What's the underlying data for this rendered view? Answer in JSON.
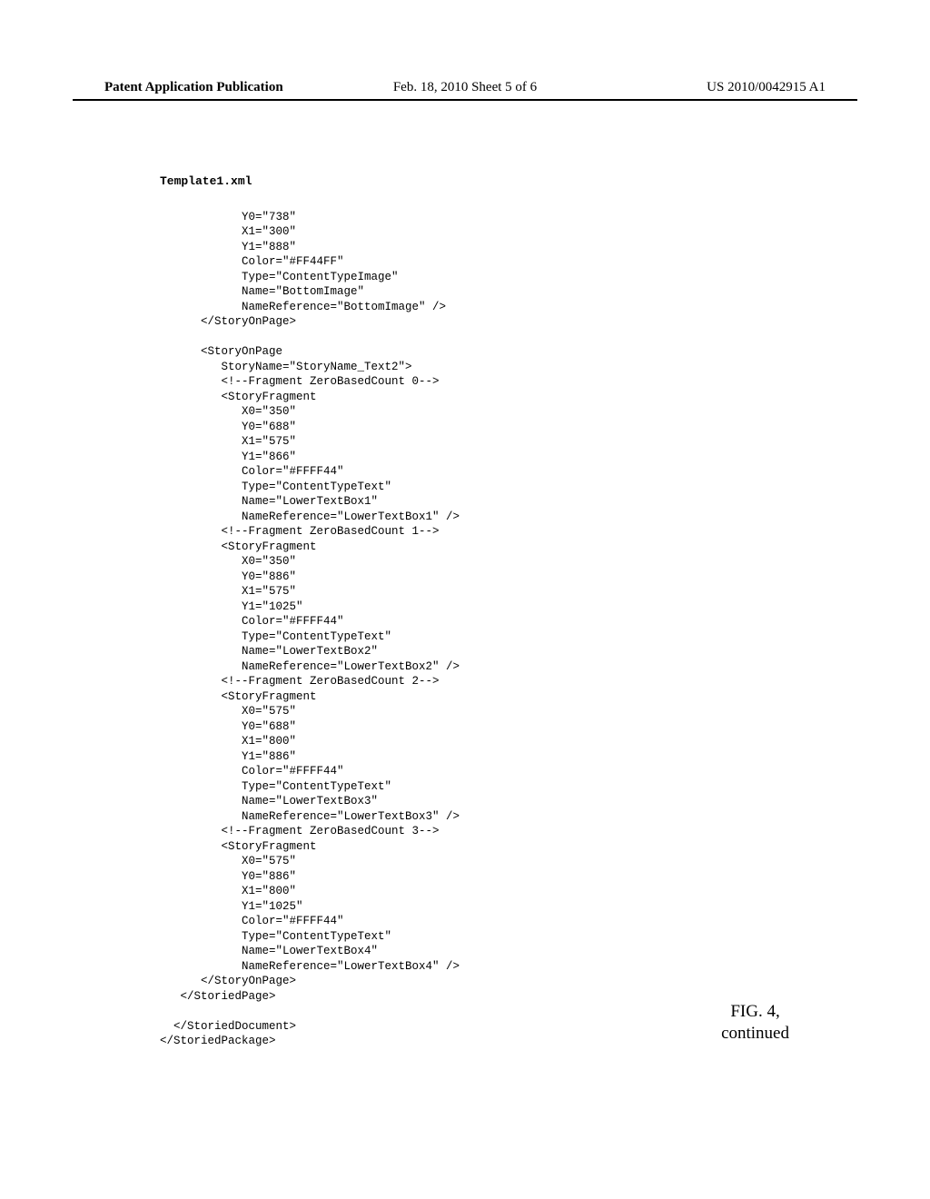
{
  "header": {
    "left": "Patent Application Publication",
    "center": "Feb. 18, 2010  Sheet 5 of 6",
    "right": "US 2010/0042915 A1"
  },
  "filename": "Template1.xml",
  "code_lines": [
    "            Y0=\"738\"",
    "            X1=\"300\"",
    "            Y1=\"888\"",
    "            Color=\"#FF44FF\"",
    "            Type=\"ContentTypeImage\"",
    "            Name=\"BottomImage\"",
    "            NameReference=\"BottomImage\" />",
    "      </StoryOnPage>",
    "",
    "      <StoryOnPage",
    "         StoryName=\"StoryName_Text2\">",
    "         <!--Fragment ZeroBasedCount 0-->",
    "         <StoryFragment",
    "            X0=\"350\"",
    "            Y0=\"688\"",
    "            X1=\"575\"",
    "            Y1=\"866\"",
    "            Color=\"#FFFF44\"",
    "            Type=\"ContentTypeText\"",
    "            Name=\"LowerTextBox1\"",
    "            NameReference=\"LowerTextBox1\" />",
    "         <!--Fragment ZeroBasedCount 1-->",
    "         <StoryFragment",
    "            X0=\"350\"",
    "            Y0=\"886\"",
    "            X1=\"575\"",
    "            Y1=\"1025\"",
    "            Color=\"#FFFF44\"",
    "            Type=\"ContentTypeText\"",
    "            Name=\"LowerTextBox2\"",
    "            NameReference=\"LowerTextBox2\" />",
    "         <!--Fragment ZeroBasedCount 2-->",
    "         <StoryFragment",
    "            X0=\"575\"",
    "            Y0=\"688\"",
    "            X1=\"800\"",
    "            Y1=\"886\"",
    "            Color=\"#FFFF44\"",
    "            Type=\"ContentTypeText\"",
    "            Name=\"LowerTextBox3\"",
    "            NameReference=\"LowerTextBox3\" />",
    "         <!--Fragment ZeroBasedCount 3-->",
    "         <StoryFragment",
    "            X0=\"575\"",
    "            Y0=\"886\"",
    "            X1=\"800\"",
    "            Y1=\"1025\"",
    "            Color=\"#FFFF44\"",
    "            Type=\"ContentTypeText\"",
    "            Name=\"LowerTextBox4\"",
    "            NameReference=\"LowerTextBox4\" />",
    "      </StoryOnPage>",
    "   </StoriedPage>",
    "",
    "  </StoriedDocument>",
    "</StoriedPackage>"
  ],
  "figure": {
    "line1": "FIG. 4,",
    "line2": "continued"
  }
}
